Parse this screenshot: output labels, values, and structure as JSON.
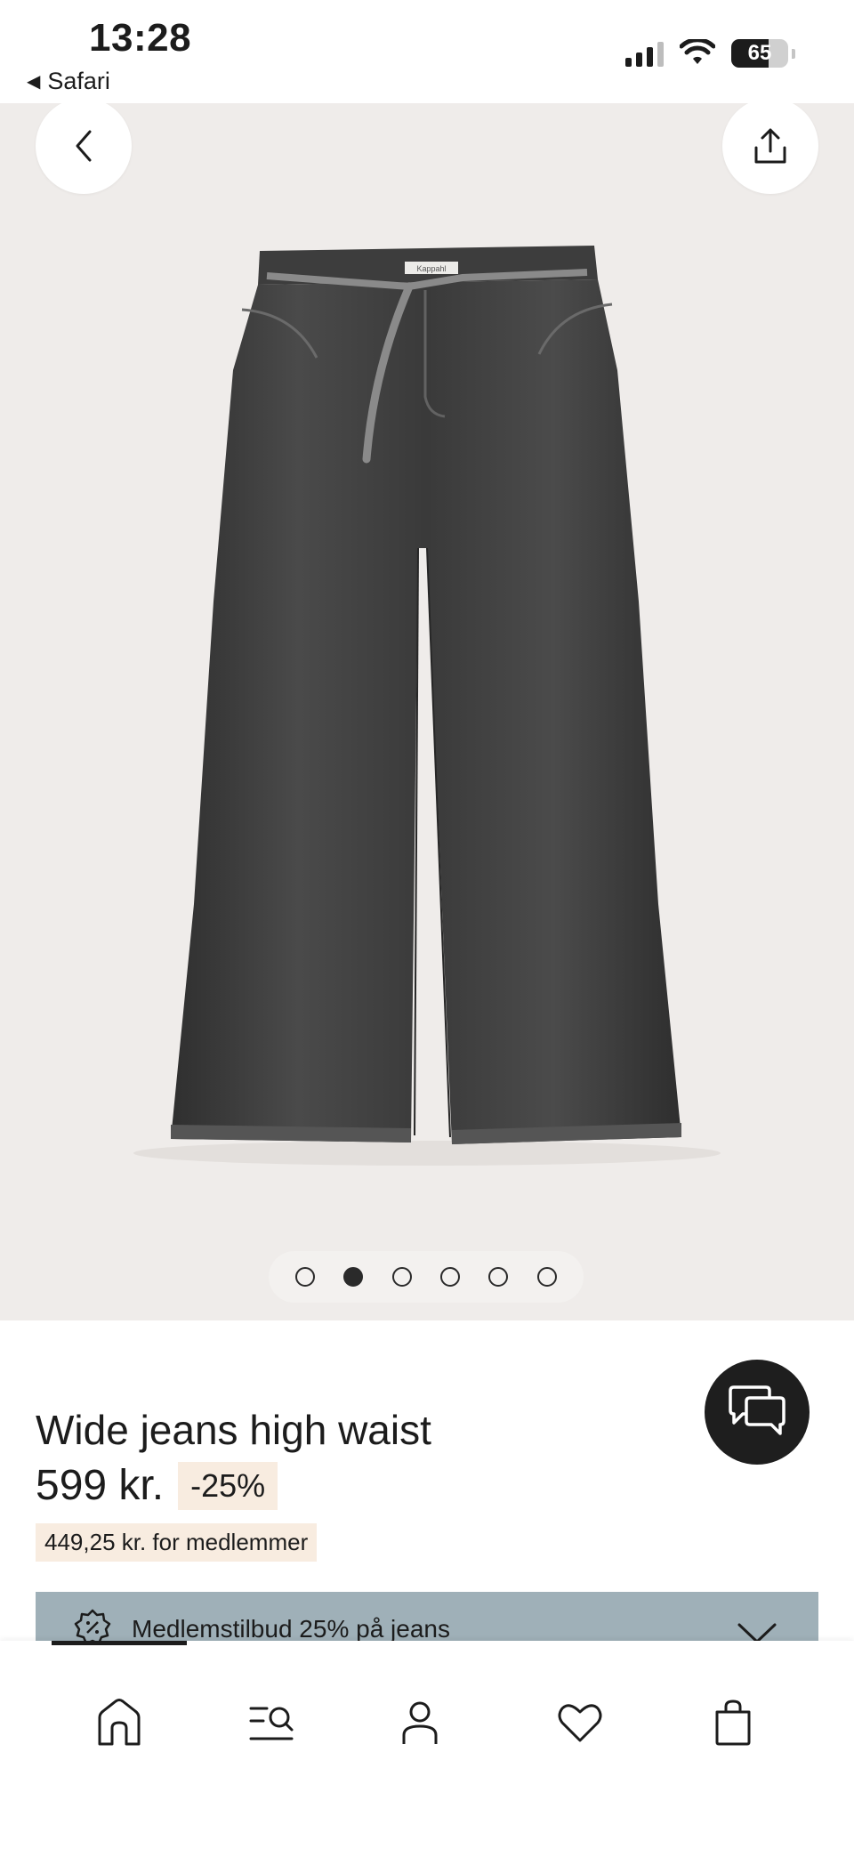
{
  "status_bar": {
    "time": "13:28",
    "back_app": "Safari",
    "battery_level": "65",
    "battery_fraction": 0.65,
    "icons": [
      "cellular-signal-icon",
      "wifi-icon",
      "battery-icon"
    ]
  },
  "hero": {
    "carousel": {
      "count": 6,
      "active_index": 1
    },
    "buttons": {
      "back": "chevron-left-icon",
      "share": "share-icon"
    },
    "label_text": "Kappahl"
  },
  "product": {
    "title": "Wide jeans high waist",
    "price": "599 kr.",
    "discount": "-25%",
    "member_price": "449,25 kr. for medlemmer"
  },
  "banner": {
    "text": "Medlemstilbud 25% på jeans",
    "icon": "discount-badge-icon"
  },
  "nav": {
    "items": [
      "home-icon",
      "search-menu-icon",
      "account-icon",
      "favorites-icon",
      "bag-icon"
    ],
    "active": 0
  },
  "colors": {
    "hero_background": "#efecea",
    "discount_background": "#f8ece0",
    "banner_background": "#9fb0b8",
    "chat_button": "#1e1e1e"
  }
}
